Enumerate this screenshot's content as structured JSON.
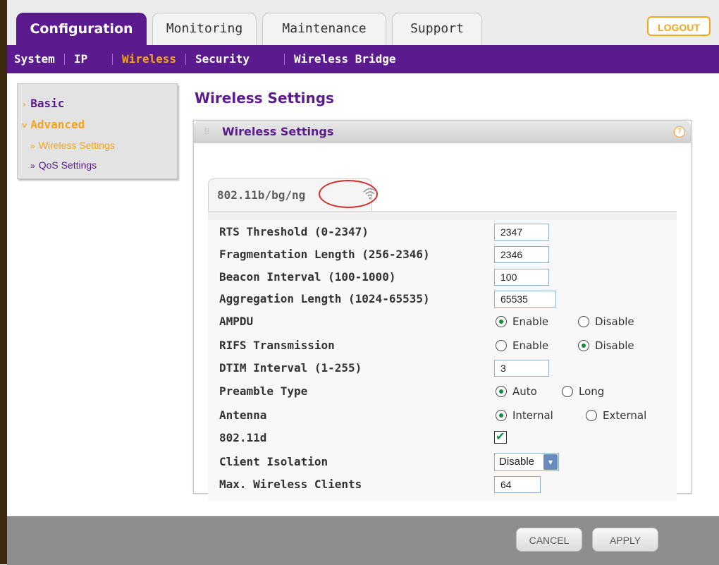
{
  "tabs": [
    "Configuration",
    "Monitoring",
    "Maintenance",
    "Support"
  ],
  "logout_label": "LOGOUT",
  "subnav": [
    "System",
    "IP",
    "Wireless",
    "Security",
    "Wireless Bridge"
  ],
  "sidebar": {
    "basic": "Basic",
    "advanced": "Advanced",
    "items": [
      "Wireless Settings",
      "QoS Settings"
    ]
  },
  "page_title": "Wireless Settings",
  "panel_title": "Wireless Settings",
  "help_glyph": "?",
  "subtab_label": "802.11b/bg/ng",
  "form": {
    "rts_label": "RTS Threshold (0-2347)",
    "rts_value": "2347",
    "frag_label": "Fragmentation Length (256-2346)",
    "frag_value": "2346",
    "beacon_label": "Beacon Interval (100-1000)",
    "beacon_value": "100",
    "agg_label": "Aggregation Length (1024-65535)",
    "agg_value": "65535",
    "ampdu_label": "AMPDU",
    "ampdu_opt1": "Enable",
    "ampdu_opt2": "Disable",
    "rifs_label": "RIFS Transmission",
    "rifs_opt1": "Enable",
    "rifs_opt2": "Disable",
    "dtim_label": "DTIM Interval (1-255)",
    "dtim_value": "3",
    "preamble_label": "Preamble Type",
    "preamble_opt1": "Auto",
    "preamble_opt2": "Long",
    "antenna_label": "Antenna",
    "antenna_opt1": "Internal",
    "antenna_opt2": "External",
    "d80211_label": "802.11d",
    "isolation_label": "Client Isolation",
    "isolation_value": "Disable",
    "maxclients_label": "Max. Wireless Clients",
    "maxclients_value": "64"
  },
  "buttons": {
    "cancel": "CANCEL",
    "apply": "APPLY"
  },
  "colors": {
    "brand_purple": "#5b1b8e",
    "accent_orange": "#f2a41d",
    "bottom_bar": "#8e8e8e",
    "highlight_ring": "#d62b2b"
  }
}
